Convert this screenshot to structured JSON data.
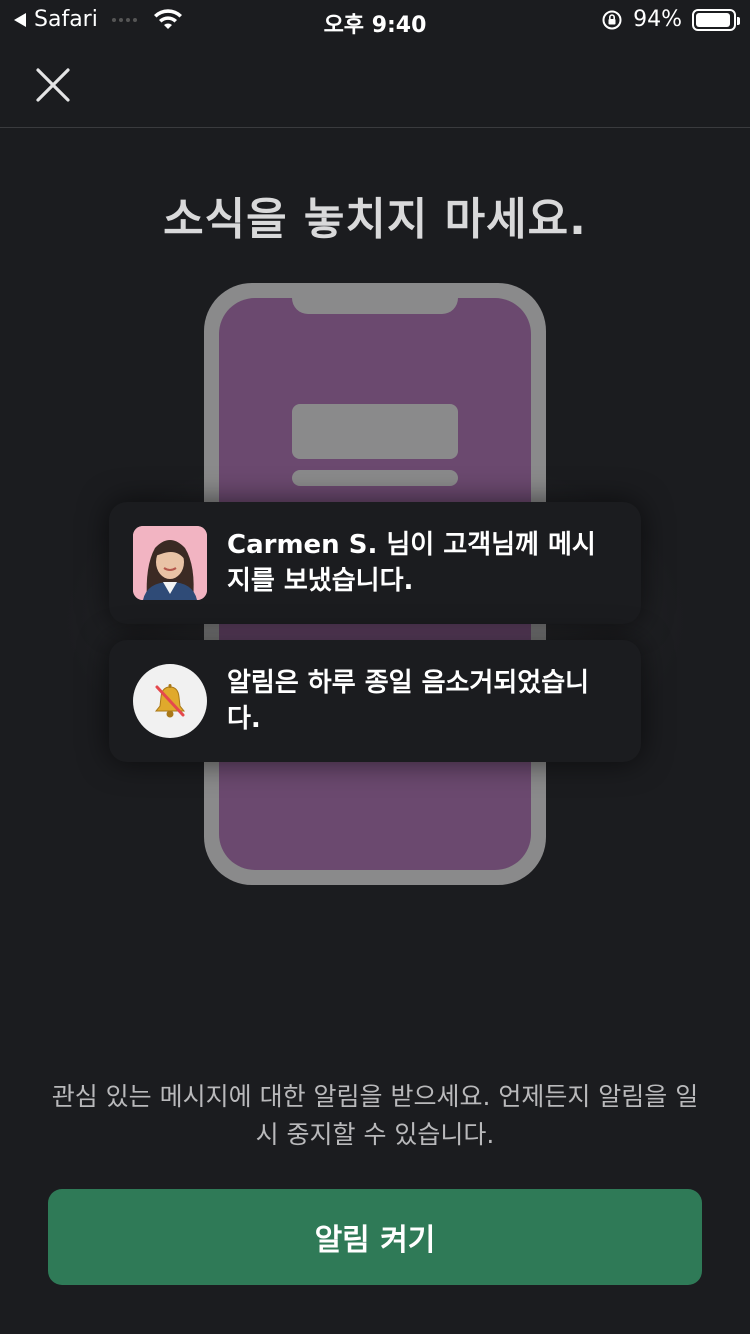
{
  "status_bar": {
    "back_app": "Safari",
    "time": "오후 9:40",
    "battery_percent": "94%",
    "battery_level": 0.94
  },
  "nav": {
    "close_icon": "close-icon"
  },
  "title": "소식을 놓치지 마세요.",
  "notifications": [
    {
      "text": "Carmen S. 님이 고객님께 메시지를 보냈습니다.",
      "icon": "avatar"
    },
    {
      "text": "알림은 하루 종일 음소거되었습니다.",
      "icon": "bell-muted-icon"
    }
  ],
  "description": "관심 있는 메시지에 대한 알림을 받으세요. 언제든지 알림을 일시 중지할 수 있습니다.",
  "cta_label": "알림 켜기",
  "colors": {
    "background": "#1b1c1f",
    "phone_screen": "#6b496f",
    "phone_frame": "#8a8a8b",
    "cta": "#2f7a57"
  }
}
